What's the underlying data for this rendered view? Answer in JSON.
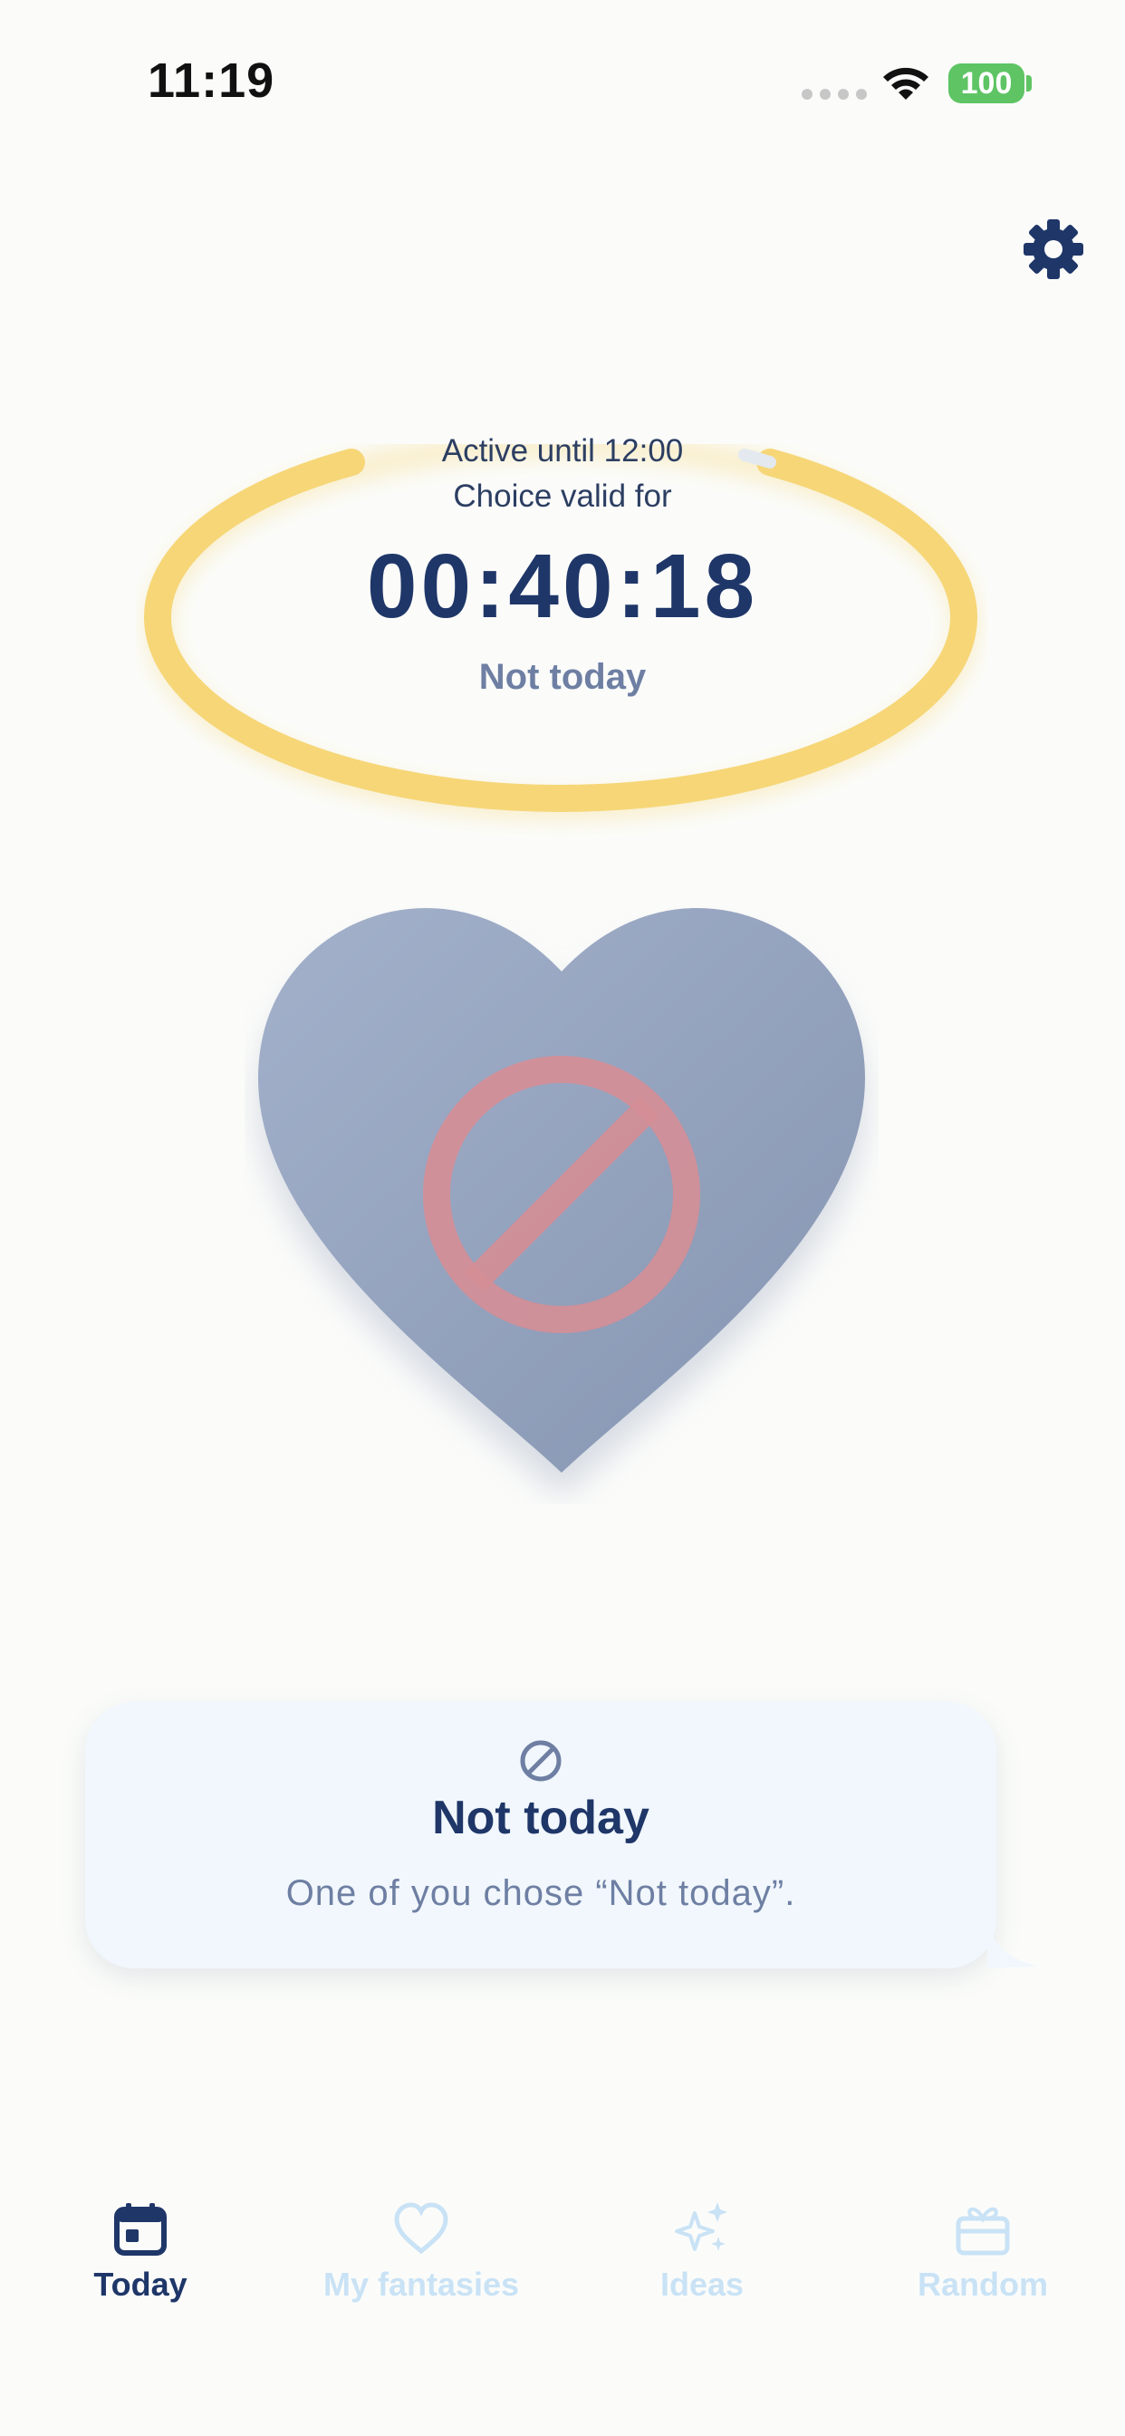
{
  "status_bar": {
    "time": "11:19",
    "battery": "100"
  },
  "ring": {
    "active_until": "Active until 12:00",
    "valid_for": "Choice valid for",
    "countdown": "00:40:18",
    "status": "Not today",
    "progress_fraction": 0.97,
    "color": "#f6d677"
  },
  "card": {
    "icon": "prohibited-icon",
    "title": "Not today",
    "text": "One of you chose “Not today”."
  },
  "tabs": [
    {
      "label": "Today",
      "icon": "calendar-icon",
      "active": true
    },
    {
      "label": "My fantasies",
      "icon": "heart-outline-icon",
      "active": false
    },
    {
      "label": "Ideas",
      "icon": "sparkles-icon",
      "active": false
    },
    {
      "label": "Random",
      "icon": "gift-icon",
      "active": false
    }
  ],
  "colors": {
    "primary": "#1f3668",
    "muted": "#6e7fa3",
    "inactive_tab": "#c9e2f5",
    "prohibit": "#d58e96"
  }
}
